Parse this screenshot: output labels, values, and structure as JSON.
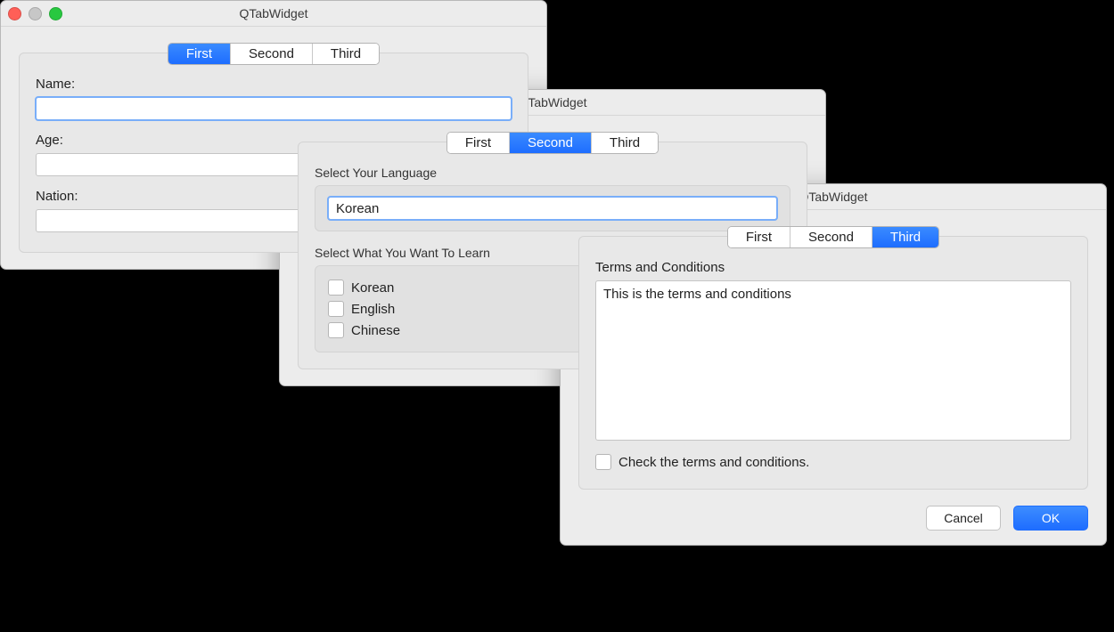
{
  "app_title": "QTabWidget",
  "tabs": {
    "first": "First",
    "second": "Second",
    "third": "Third"
  },
  "win1": {
    "title": "QTabWidget",
    "active_tab": "first",
    "fields": {
      "name_label": "Name:",
      "name_value": "",
      "age_label": "Age:",
      "age_value": "",
      "nation_label": "Nation:",
      "nation_value": ""
    }
  },
  "win2": {
    "title": "QTabWidget",
    "active_tab": "second",
    "select_lang_label": "Select Your Language",
    "selected_language": "Korean",
    "learn_label": "Select What You Want To Learn",
    "learn_options": [
      "Korean",
      "English",
      "Chinese"
    ]
  },
  "win3": {
    "title": "QTabWidget",
    "active_tab": "third",
    "terms_label": "Terms and Conditions",
    "terms_body": "This is the terms and conditions",
    "check_label": "Check the terms and conditions.",
    "cancel": "Cancel",
    "ok": "OK"
  }
}
